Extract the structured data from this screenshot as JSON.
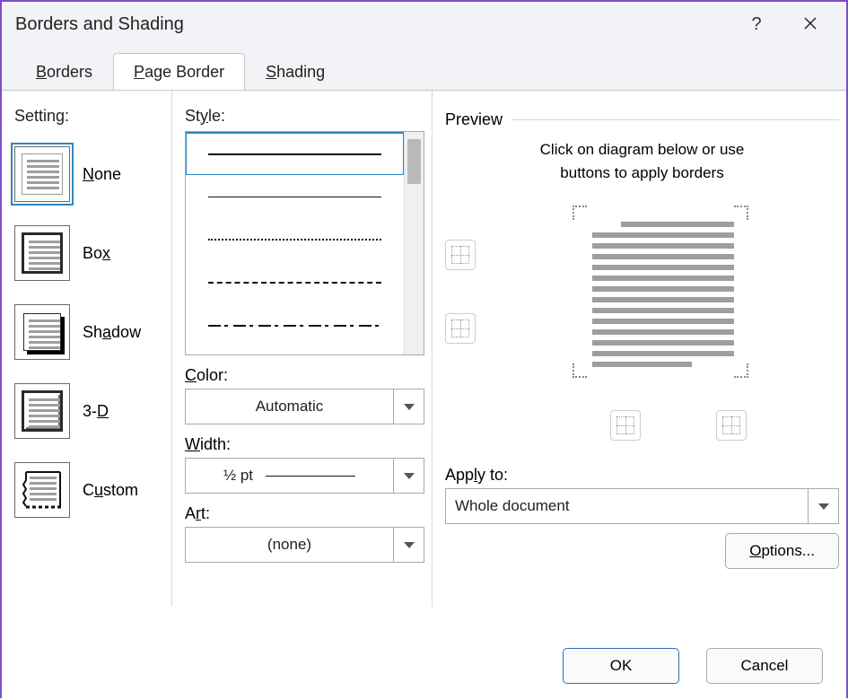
{
  "window": {
    "title": "Borders and Shading"
  },
  "tabs": {
    "borders": "Borders",
    "page_border": "Page Border",
    "shading": "Shading",
    "active_index": 1
  },
  "setting": {
    "label": "Setting:",
    "items": [
      {
        "name": "None"
      },
      {
        "name": "Box"
      },
      {
        "name": "Shadow"
      },
      {
        "name": "3-D"
      },
      {
        "name": "Custom"
      }
    ],
    "selected_index": 0
  },
  "style": {
    "label": "Style:",
    "options": [
      "solid",
      "thin",
      "dots",
      "dash",
      "dashdot"
    ],
    "selected_index": 0
  },
  "color": {
    "label": "Color:",
    "value": "Automatic"
  },
  "width": {
    "label": "Width:",
    "value": "½ pt"
  },
  "art": {
    "label": "Art:",
    "value": "(none)"
  },
  "preview": {
    "label": "Preview",
    "hint_line1": "Click on diagram below or use",
    "hint_line2": "buttons to apply borders"
  },
  "apply_to": {
    "label": "Apply to:",
    "value": "Whole document"
  },
  "buttons": {
    "options": "Options...",
    "ok": "OK",
    "cancel": "Cancel"
  }
}
